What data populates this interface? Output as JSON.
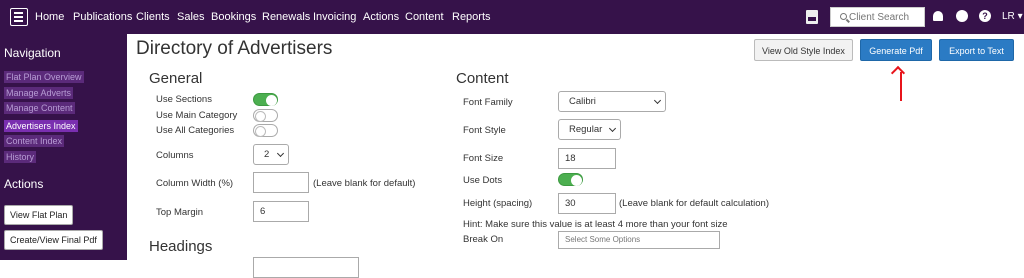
{
  "topbar": {
    "nav": [
      "Home",
      "Publications",
      "Clients",
      "Sales",
      "Bookings",
      "Renewals",
      "Invoicing",
      "Actions",
      "Content",
      "Reports"
    ],
    "search_placeholder": "Client Search",
    "user": "LR"
  },
  "sidebar": {
    "navigation_heading": "Navigation",
    "nav_items": [
      "Flat Plan Overview",
      "Manage Adverts",
      "Manage Content",
      "Advertisers Index",
      "Content Index",
      "History"
    ],
    "actions_heading": "Actions",
    "actions": [
      "View Flat Plan",
      "Create/View Final Pdf"
    ]
  },
  "page": {
    "title": "Directory of Advertisers",
    "buttons": {
      "old_style": "View Old Style Index",
      "generate_pdf": "Generate Pdf",
      "export_text": "Export to Text"
    }
  },
  "general": {
    "heading": "General",
    "use_sections": "Use Sections",
    "use_main_category": "Use Main Category",
    "use_all_categories": "Use All Categories",
    "columns_label": "Columns",
    "columns_value": "2",
    "column_width_label": "Column Width (%)",
    "column_width_value": "",
    "column_width_hint": "(Leave blank for default)",
    "top_margin_label": "Top Margin",
    "top_margin_value": "6"
  },
  "headings": {
    "heading": "Headings"
  },
  "content": {
    "heading": "Content",
    "font_family_label": "Font Family",
    "font_family_value": "Calibri",
    "font_style_label": "Font Style",
    "font_style_value": "Regular",
    "font_size_label": "Font Size",
    "font_size_value": "18",
    "use_dots_label": "Use Dots",
    "height_label": "Height (spacing)",
    "height_value": "30",
    "height_hint": "(Leave blank for default calculation)",
    "hint": "Hint: Make sure this value is at least 4 more than your font size",
    "break_on_label": "Break On",
    "break_on_placeholder": "Select Some Options"
  }
}
